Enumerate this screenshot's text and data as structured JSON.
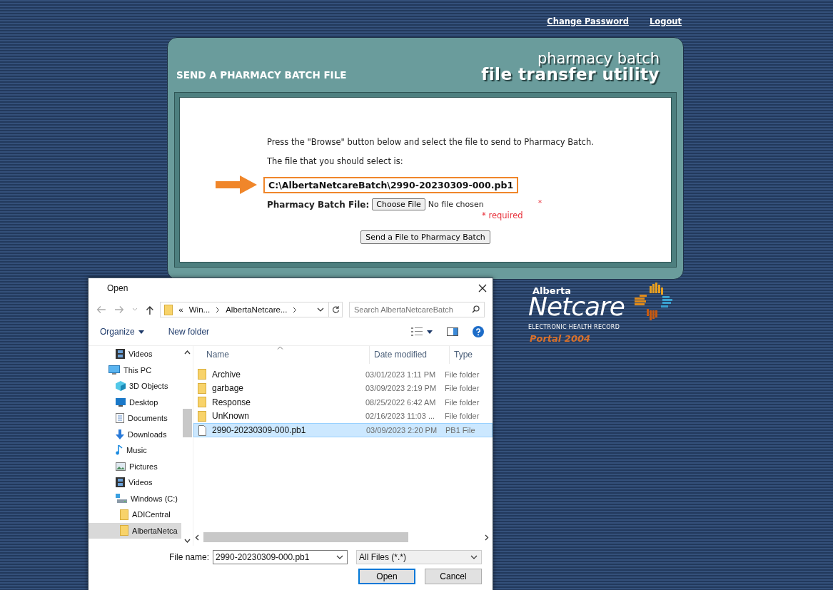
{
  "header_links": [
    {
      "label": "Change Password"
    },
    {
      "label": "Logout"
    }
  ],
  "panel": {
    "title": "SEND A PHARMACY BATCH FILE",
    "brand_top": "pharmacy batch",
    "brand_bottom": "file transfer utility",
    "instruction": "Press the \"Browse\" button below and select the file to send to Pharmacy Batch.",
    "prompt": "The file that you should select is:",
    "file_path": "C:\\AlbertaNetcareBatch\\2990-20230309-000.pb1",
    "field_label": "Pharmacy Batch File:",
    "choose_button": "Choose File",
    "no_file": "No file chosen",
    "required_mark": "*",
    "required_note": "* required",
    "submit_button": "Send a File to Pharmacy Batch"
  },
  "logo": {
    "region": "Alberta",
    "name": "Netcare",
    "tagline": "ELECTRONIC HEALTH RECORD",
    "edition": "Portal 2004"
  },
  "dialog": {
    "title": "Open",
    "address": {
      "overflow": "«",
      "crumbs": [
        "Win...",
        "AlbertaNetcare..."
      ]
    },
    "search": {
      "placeholder": "Search AlbertaNetcareBatch"
    },
    "organize": "Organize",
    "new_folder": "New folder",
    "nav": [
      {
        "label": "Videos",
        "kind": "videos",
        "selected": false
      },
      {
        "label": "This PC",
        "kind": "pc",
        "selected": false,
        "children": [
          {
            "label": "3D Objects",
            "kind": "cube",
            "selected": false
          },
          {
            "label": "Desktop",
            "kind": "desktop",
            "selected": false
          },
          {
            "label": "Documents",
            "kind": "documents",
            "selected": false
          },
          {
            "label": "Downloads",
            "kind": "downloads",
            "selected": false
          },
          {
            "label": "Music",
            "kind": "music",
            "selected": false
          },
          {
            "label": "Pictures",
            "kind": "pictures",
            "selected": false
          },
          {
            "label": "Videos",
            "kind": "videos",
            "selected": false
          },
          {
            "label": "Windows (C:)",
            "kind": "drive",
            "selected": false,
            "children": [
              {
                "label": "ADICentral",
                "kind": "folder",
                "selected": false
              },
              {
                "label": "AlbertaNetca",
                "kind": "folder",
                "selected": true
              }
            ]
          }
        ]
      }
    ],
    "columns": [
      "Name",
      "Date modified",
      "Type"
    ],
    "files": [
      {
        "name": "Archive",
        "date": "03/01/2023 1:11 PM",
        "type": "File folder",
        "kind": "folder",
        "selected": false
      },
      {
        "name": "garbage",
        "date": "03/09/2023 2:19 PM",
        "type": "File folder",
        "kind": "folder",
        "selected": false
      },
      {
        "name": "Response",
        "date": "08/25/2022 6:42 AM",
        "type": "File folder",
        "kind": "folder",
        "selected": false
      },
      {
        "name": "UnKnown",
        "date": "02/16/2023 11:03 ...",
        "type": "File folder",
        "kind": "folder",
        "selected": false
      },
      {
        "name": "2990-20230309-000.pb1",
        "date": "03/09/2023 2:20 PM",
        "type": "PB1 File",
        "kind": "file",
        "selected": true
      }
    ],
    "file_name": {
      "label": "File name:",
      "value": "2990-20230309-000.pb1"
    },
    "filter": "All Files (*.*)",
    "buttons": [
      {
        "label": "Open",
        "default": true
      },
      {
        "label": "Cancel",
        "default": false
      }
    ]
  }
}
